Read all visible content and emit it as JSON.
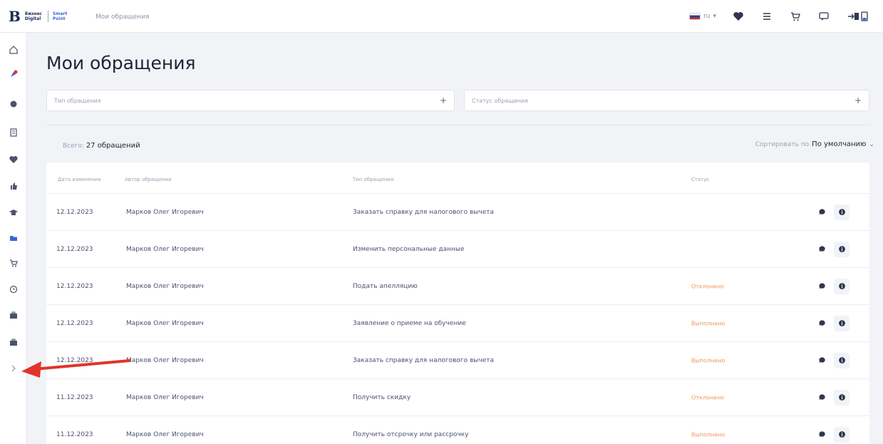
{
  "header": {
    "logo_letter": "B",
    "logo_text": "Бизнес Digital",
    "logo_sub": "Smart Point",
    "breadcrumb": "Мои обращения",
    "language": "ru"
  },
  "page": {
    "title": "Мои обращения"
  },
  "filters": {
    "type_placeholder": "Тип обращения",
    "status_placeholder": "Статус обращения",
    "plus_glyph": "+"
  },
  "summary": {
    "total_prefix": "Всего:",
    "total_value": "27 обращений",
    "sort_prefix": "Сортировать по",
    "sort_value": "По умолчанию",
    "sort_chevron": "⌄"
  },
  "table": {
    "columns": [
      "Дата изменения",
      "Автор обращения",
      "Тип обращения",
      "Статус"
    ],
    "rows": [
      {
        "date": "12.12.2023",
        "author": "Марков Олег Игоревич",
        "type": "Заказать справку для налогового вычета",
        "status": ""
      },
      {
        "date": "12.12.2023",
        "author": "Марков Олег Игоревич",
        "type": "Изменить персональные данные",
        "status": ""
      },
      {
        "date": "12.12.2023",
        "author": "Марков Олег Игоревич",
        "type": "Подать апелляцию",
        "status": "Отклонено"
      },
      {
        "date": "12.12.2023",
        "author": "Марков Олег Игоревич",
        "type": "Заявление о приеме на обучение",
        "status": "Выполнено"
      },
      {
        "date": "12.12.2023",
        "author": "Марков Олег Игоревич",
        "type": "Заказать справку для налогового вычета",
        "status": "Выполнено"
      },
      {
        "date": "11.12.2023",
        "author": "Марков Олег Игоревич",
        "type": "Получить скидку",
        "status": "Отклонено"
      },
      {
        "date": "11.12.2023",
        "author": "Марков Олег Игоревич",
        "type": "Получить отсрочку или рассрочку",
        "status": "Выполнено"
      }
    ]
  },
  "colors": {
    "accent": "#3a66d6",
    "status_orange": "#f0975a",
    "annotation_arrow": "#e2332b",
    "heart_red": "#e2332b"
  }
}
